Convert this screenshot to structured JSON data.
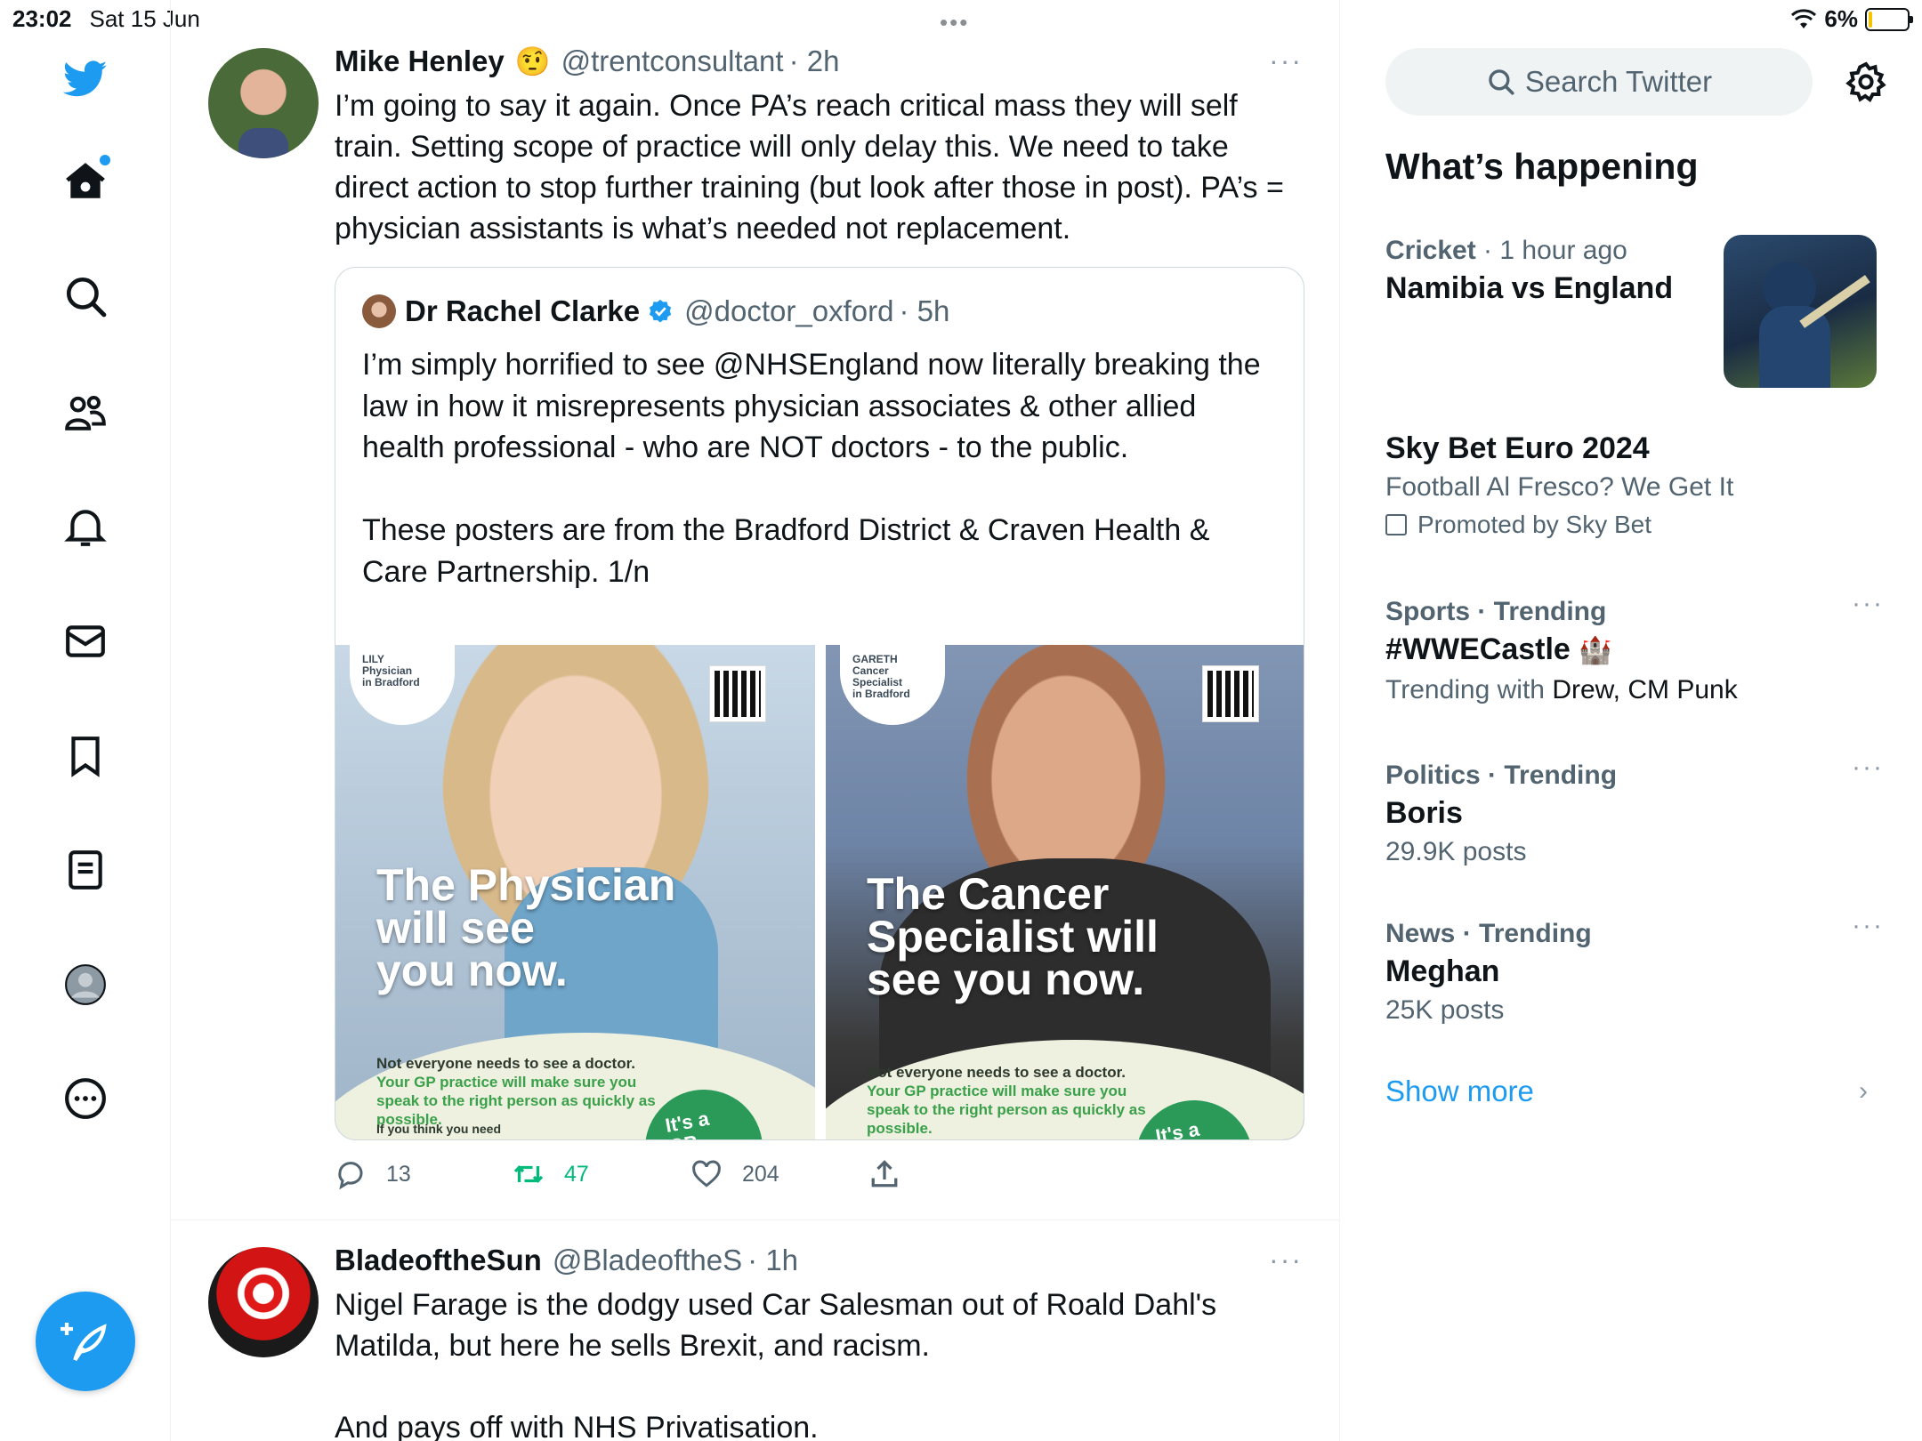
{
  "status_bar": {
    "time": "23:02",
    "date": "Sat 15 Jun",
    "battery": "6%",
    "battery_level": 0.06
  },
  "nav": {
    "items": [
      "twitter-logo",
      "home",
      "explore",
      "communities",
      "notifications",
      "messages",
      "bookmarks",
      "lists",
      "profile",
      "more"
    ]
  },
  "tweets": [
    {
      "name": "Mike Henley",
      "emoji": "🤨",
      "handle": "@trentconsultant",
      "time": "· 2h",
      "text": "I’m going to say it again. Once PA’s reach critical mass they will self train. Setting scope of practice will only delay this. We need to take direct action to stop further training (but look after those in post). PA’s = physician assistants is what’s needed not replacement.",
      "quote": {
        "name": "Dr Rachel Clarke",
        "handle": "@doctor_oxford",
        "time": "· 5h",
        "text": "I’m simply horrified to see @NHSEngland now literally breaking the law in how it misrepresents physician associates & other allied health professional - who are NOT doctors - to the public.\n\nThese posters are from the Bradford District & Craven Health & Care Partnership. 1/n",
        "posters": [
          {
            "badge": "LILY\nPhysician\nin Bradford",
            "headline": "The Physician\nwill see\nyou now.",
            "bottom_a": "Not everyone needs to see a doctor. ",
            "bottom_b": "Your GP practice will make sure you speak to the right person as quickly as possible.",
            "circle": "It's a\nGP\npractice",
            "small": "If you think you need"
          },
          {
            "badge": "GARETH\nCancer\nSpecialist\nin Bradford",
            "headline": "The Cancer\nSpecialist will\nsee you now.",
            "bottom_a": "Not everyone needs to see a doctor. ",
            "bottom_b": "Your GP practice will make sure you speak to the right person as quickly as possible.",
            "circle": "It's a\nGP\npractice",
            "small": ""
          }
        ]
      },
      "actions": {
        "replies": "13",
        "retweets": "47",
        "likes": "204"
      }
    },
    {
      "name": "BladeoftheSun",
      "handle": "@BladeoftheS",
      "time": "· 1h",
      "text": "Nigel Farage is the dodgy used Car Salesman out of Roald Dahl's Matilda, but here he sells Brexit, and racism.\n\nAnd pays off with NHS Privatisation."
    }
  ],
  "sidebar": {
    "search_placeholder": "Search Twitter",
    "title": "What’s happening",
    "trends": [
      {
        "category": "Cricket",
        "meta": " · 1 hour ago",
        "name": "Namibia vs England"
      },
      {
        "name": "Sky Bet Euro 2024",
        "sub": "Football Al Fresco? We Get It",
        "promo": "Promoted by Sky Bet"
      },
      {
        "category": "Sports · Trending",
        "name": "#WWECastle",
        "sub_prefix": "Trending with ",
        "sub_dark": "Drew, CM Punk"
      },
      {
        "category": "Politics · Trending",
        "name": "Boris",
        "sub": "29.9K posts"
      },
      {
        "category": "News · Trending",
        "name": "Meghan",
        "sub": "25K posts"
      }
    ],
    "show_more": "Show more"
  },
  "colors": {
    "accent": "#1d9bf0",
    "retweet": "#00ba7c",
    "muted": "#536471"
  }
}
